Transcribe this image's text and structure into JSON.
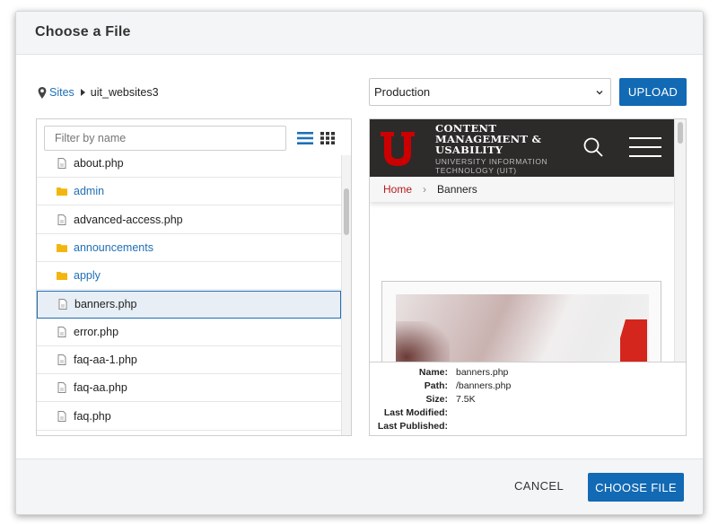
{
  "modal": {
    "title": "Choose a File"
  },
  "breadcrumb": {
    "icon": "map-pin-icon",
    "root": "Sites",
    "current": "uit_websites3"
  },
  "environment": {
    "selected": "Production"
  },
  "upload_label": "UPLOAD",
  "filter": {
    "placeholder": "Filter by name",
    "value": ""
  },
  "view_toggle": {
    "list_icon": "list-view-icon",
    "grid_icon": "grid-view-icon",
    "active": "list"
  },
  "files": [
    {
      "name": "about.php",
      "type": "file"
    },
    {
      "name": "admin",
      "type": "folder"
    },
    {
      "name": "advanced-access.php",
      "type": "file"
    },
    {
      "name": "announcements",
      "type": "folder"
    },
    {
      "name": "apply",
      "type": "folder"
    },
    {
      "name": "banners.php",
      "type": "file",
      "selected": true
    },
    {
      "name": "error.php",
      "type": "file"
    },
    {
      "name": "faq-aa-1.php",
      "type": "file"
    },
    {
      "name": "faq-aa.php",
      "type": "file"
    },
    {
      "name": "faq.php",
      "type": "file"
    }
  ],
  "preview": {
    "site_title_lines": [
      "CONTENT",
      "MANAGEMENT &",
      "USABILITY"
    ],
    "site_sub_lines": [
      "UNIVERSITY INFORMATION",
      "TECHNOLOGY (UIT)"
    ],
    "breadcrumb_home": "Home",
    "breadcrumb_sep": "›",
    "breadcrumb_current": "Banners",
    "colors": {
      "header_bg": "#2d2a2a",
      "logo_red": "#cc0000",
      "home_link": "#b41b1b"
    }
  },
  "meta": {
    "name_label": "Name:",
    "name": "banners.php",
    "path_label": "Path:",
    "path": "/banners.php",
    "size_label": "Size:",
    "size": "7.5K",
    "modified_label": "Last Modified:",
    "modified": "",
    "published_label": "Last Published:",
    "published": ""
  },
  "footer": {
    "cancel_label": "CANCEL",
    "choose_label": "CHOOSE FILE"
  },
  "colors": {
    "primary": "#1269b4",
    "link": "#1f6fb5",
    "folder": "#f2b60f"
  }
}
